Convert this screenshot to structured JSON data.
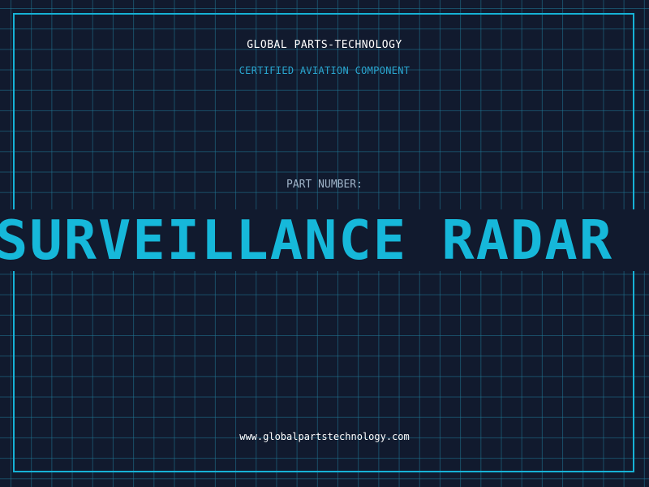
{
  "company_name": "GLOBAL PARTS-TECHNOLOGY",
  "tagline": "CERTIFIED AVIATION COMPONENT",
  "part_label": "PART NUMBER:",
  "part_value": "SURVEILLANCE RADAR",
  "website": "www.globalpartstechnology.com",
  "colors": {
    "background": "#111a2e",
    "grid": "#1f7896",
    "accent": "#16b8da",
    "text": "#ffffff",
    "muted_text": "#9fb3c8"
  }
}
